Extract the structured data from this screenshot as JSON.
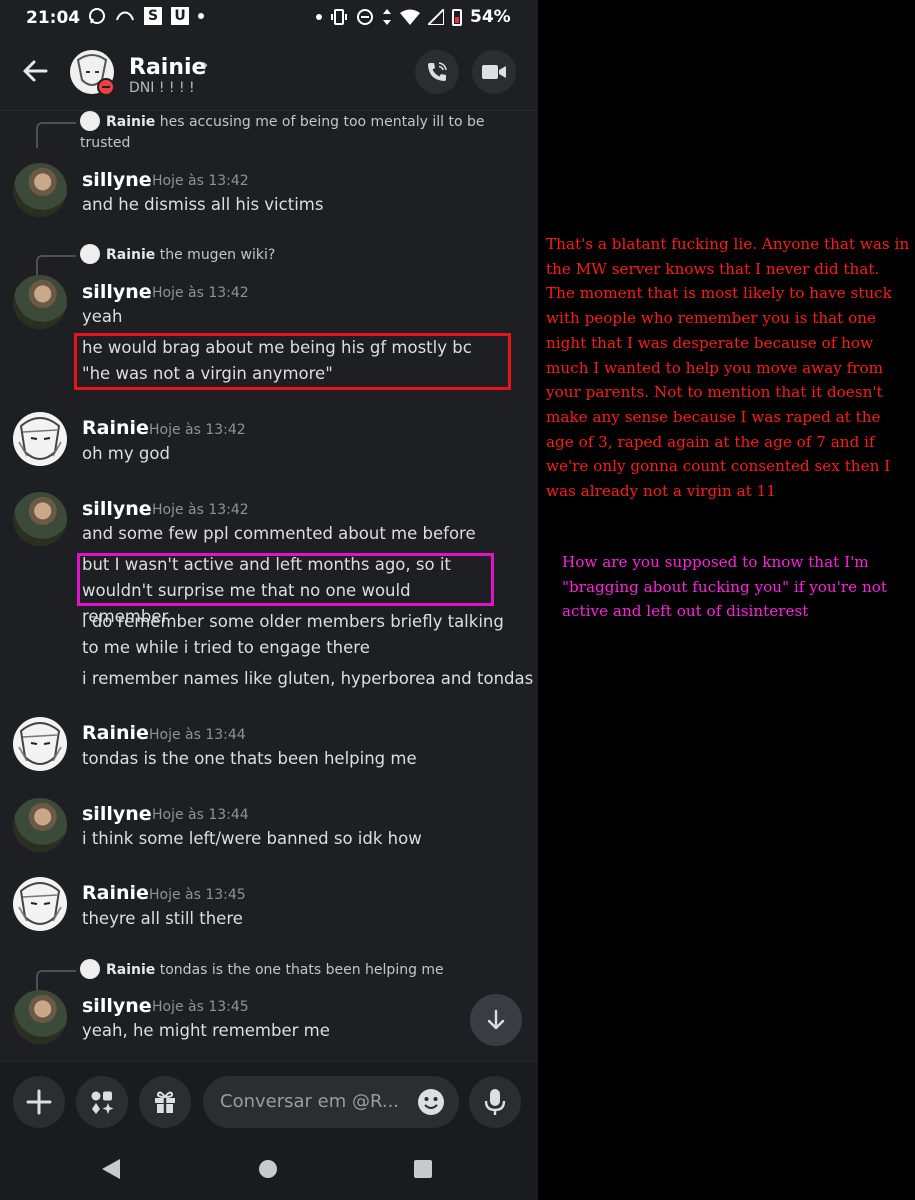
{
  "status_bar": {
    "time": "21:04",
    "battery": "54%",
    "icons": [
      "whatsapp-icon",
      "signal-app-icon",
      "s-icon",
      "u-icon",
      "dot-icon",
      "vibrate-icon",
      "dnd-icon",
      "data-arrows-icon",
      "wifi-icon",
      "cell-signal-icon",
      "battery-icon"
    ],
    "icon_letters": {
      "s": "S",
      "u": "U"
    }
  },
  "header": {
    "name": "Rainie",
    "status": "DNI ! ! ! !",
    "icons": [
      "back-arrow-icon",
      "chevron-right-icon",
      "phone-icon",
      "video-icon"
    ]
  },
  "messages": [
    {
      "type": "reply_ref",
      "author": "Rainie",
      "text": "hes accusing me of being too mentaly ill to be trusted"
    },
    {
      "type": "message",
      "author": "sillyne",
      "time": "Hoje às 13:42",
      "lines": [
        "and he dismiss all his victims"
      ]
    },
    {
      "type": "reply_ref",
      "author": "Rainie",
      "text": "the mugen wiki?"
    },
    {
      "type": "message",
      "author": "sillyne",
      "time": "Hoje às 13:42",
      "lines": [
        "yeah",
        "he would brag about me being his gf mostly bc \"he was not a virgin anymore\""
      ]
    },
    {
      "type": "message",
      "author": "Rainie",
      "time": "Hoje às 13:42",
      "lines": [
        "oh my god"
      ]
    },
    {
      "type": "message",
      "author": "sillyne",
      "time": "Hoje às 13:42",
      "lines": [
        "and some few ppl commented about me before",
        "but I wasn't active and left months ago, so it wouldn't surprise me that no one would remember",
        "i do remember some older members briefly talking to me while i tried to engage there",
        "i remember names like gluten, hyperborea and tondas"
      ]
    },
    {
      "type": "message",
      "author": "Rainie",
      "time": "Hoje às 13:44",
      "lines": [
        "tondas is the one thats been helping me"
      ]
    },
    {
      "type": "message",
      "author": "sillyne",
      "time": "Hoje às 13:44",
      "lines": [
        "i think some left/were banned so idk how"
      ]
    },
    {
      "type": "message",
      "author": "Rainie",
      "time": "Hoje às 13:45",
      "lines": [
        "theyre all still there"
      ]
    },
    {
      "type": "reply_ref",
      "author": "Rainie",
      "text": "tondas is the one thats been helping me"
    },
    {
      "type": "message",
      "author": "sillyne",
      "time": "Hoje às 13:45",
      "lines": [
        "yeah, he might remember me"
      ]
    }
  ],
  "composer": {
    "placeholder": "Conversar em @R...",
    "icons": [
      "plus-icon",
      "apps-icon",
      "gift-icon",
      "emoji-icon",
      "microphone-icon"
    ]
  },
  "scroll_button": {
    "icon": "arrow-down-icon"
  },
  "nav_bar": {
    "icons": [
      "back-triangle-icon",
      "home-circle-icon",
      "recents-square-icon"
    ]
  },
  "annotations": {
    "red": "That's a blatant fucking lie. Anyone that was in the MW server knows that I never did that. The moment that is most likely to have stuck with people who remember you is that one night that I was desperate because of how much I wanted to help you move away from your parents. Not to mention that it doesn't make any sense because I was raped at the age of 3, raped again at the age of 7 and if we're only gonna count consented sex then I was already not a virgin at 11",
    "magenta": "How are you supposed to know that I'm \"bragging about fucking you\" if you're not active and left out of disinterest"
  },
  "colors": {
    "background": "#1e1f23",
    "highlight_red": "#e4141b",
    "highlight_magenta": "#e013c8",
    "annotation_red": "#ff1a1a",
    "annotation_magenta": "#ff20e0",
    "dnd": "#f23f43"
  }
}
